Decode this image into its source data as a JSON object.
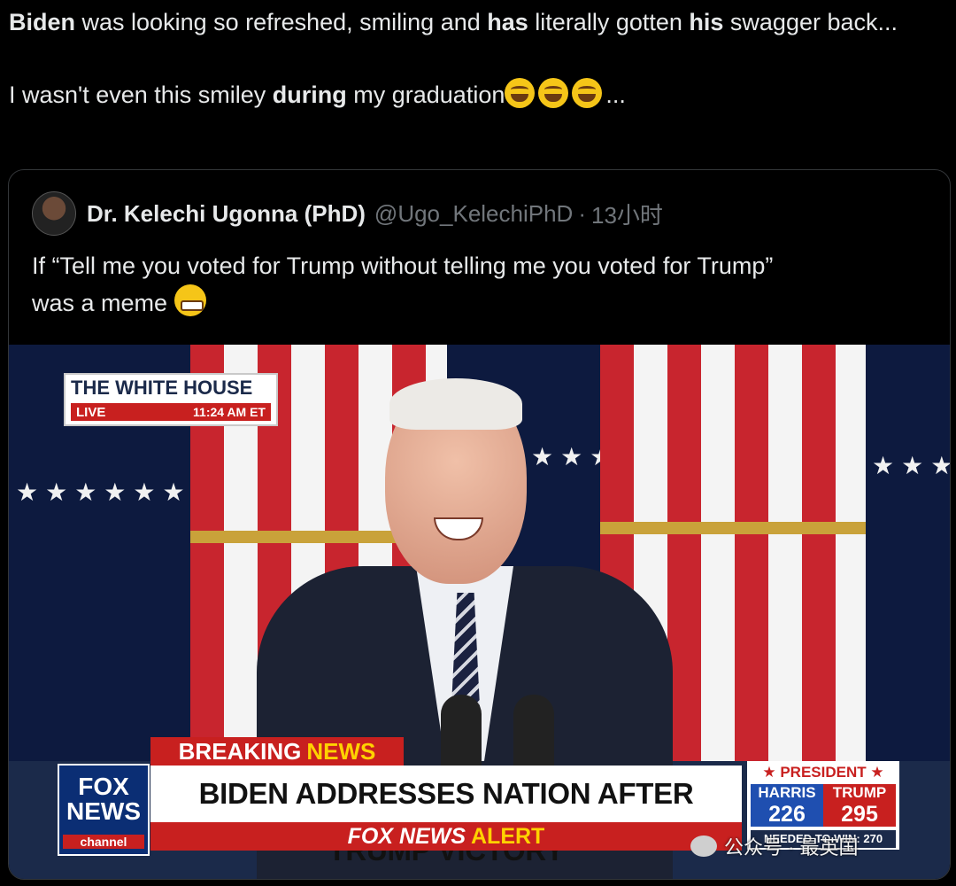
{
  "tweet": {
    "line1_b1": "Biden",
    "line1_t1": " was looking so refreshed, smiling and ",
    "line1_b2": "has",
    "line1_t2": " literally gotten ",
    "line1_b3": "his",
    "line1_t3": " swagger back...",
    "line2_t1": "I wasn't even this smiley ",
    "line2_b1": "during",
    "line2_t2": " my graduation",
    "line2_end": "...",
    "emojis": [
      "face-with-tears-of-joy",
      "face-with-tears-of-joy",
      "face-with-tears-of-joy"
    ]
  },
  "quoted_tweet": {
    "author_name": "Dr. Kelechi Ugonna (PhD)",
    "handle": "@Ugo_KelechiPhD",
    "separator": "·",
    "time": "13小时",
    "text_line1": "If “Tell me you voted for Trump without telling me you voted for Trump”",
    "text_line2": "was a meme",
    "emoji": "grimacing-face"
  },
  "broadcast": {
    "location": "THE WHITE HOUSE",
    "live": "LIVE",
    "time": "11:24 AM ET",
    "breaking_1": "BREAKING",
    "breaking_2": "NEWS",
    "logo_line1": "FOX",
    "logo_line2": "NEWS",
    "logo_line3": "channel",
    "headline": "BIDEN ADDRESSES NATION AFTER TRUMP VICTORY",
    "alert_1": "FOX NEWS",
    "alert_2": "ALERT",
    "election_title": "★ PRESIDENT ★",
    "harris_label": "HARRIS",
    "harris_count": "226",
    "trump_label": "TRUMP",
    "trump_count": "295",
    "needed": "NEEDED TO WIN: 270"
  },
  "watermark": "公众号 · 最英国",
  "colors": {
    "background": "#000000",
    "text": "#e7e9ea",
    "muted": "#71767b",
    "fox_red": "#c8201f",
    "fox_blue": "#0b2e74",
    "news_yellow": "#ffd200"
  }
}
